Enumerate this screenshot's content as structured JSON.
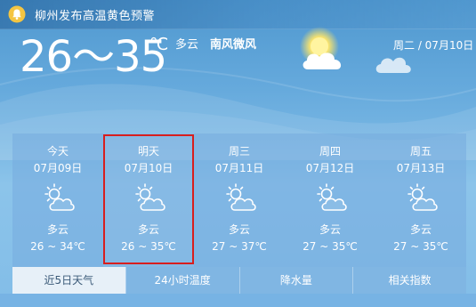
{
  "alert": {
    "text": "柳州发布高温黄色预警",
    "icon": "bell-icon",
    "icon_color": "#f4c542"
  },
  "current": {
    "temp_range": "26～35",
    "unit": "℃",
    "condition": "多云",
    "wind": "南风微风",
    "date": "周二 / 07月10日",
    "weather_icon": "sun-cloud-icon"
  },
  "forecast": [
    {
      "day": "今天",
      "date": "07月09日",
      "condition": "多云",
      "temp": "26 ~ 34℃",
      "icon": "partly-cloudy-icon"
    },
    {
      "day": "明天",
      "date": "07月10日",
      "condition": "多云",
      "temp": "26 ~ 35℃",
      "icon": "partly-cloudy-icon"
    },
    {
      "day": "周三",
      "date": "07月11日",
      "condition": "多云",
      "temp": "27 ~ 37℃",
      "icon": "partly-cloudy-icon"
    },
    {
      "day": "周四",
      "date": "07月12日",
      "condition": "多云",
      "temp": "27 ~ 35℃",
      "icon": "partly-cloudy-icon"
    },
    {
      "day": "周五",
      "date": "07月13日",
      "condition": "多云",
      "temp": "27 ~ 35℃",
      "icon": "partly-cloudy-icon"
    }
  ],
  "tabs": [
    {
      "label": "近5日天气",
      "active": true
    },
    {
      "label": "24小时温度",
      "active": false
    },
    {
      "label": "降水量",
      "active": false
    },
    {
      "label": "相关指数",
      "active": false
    }
  ],
  "colors": {
    "sky_top": "#4f98cf",
    "sky_bottom": "#82bde8",
    "highlight": "#d81e1e",
    "active_tab_bg": "#e7f0f8",
    "active_tab_text": "#3b5a78"
  }
}
